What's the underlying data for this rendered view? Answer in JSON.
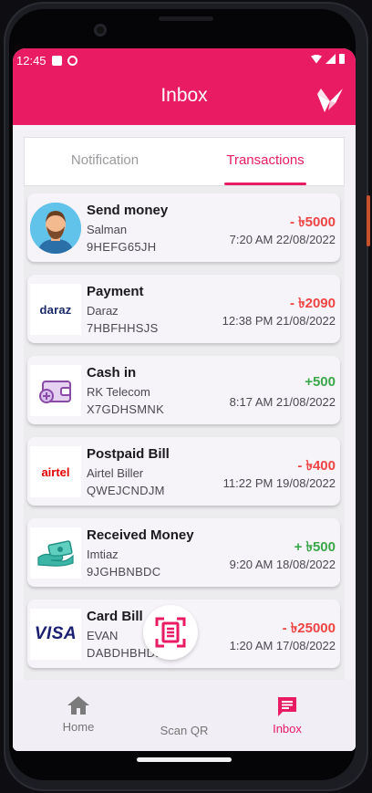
{
  "status_bar": {
    "time": "12:45"
  },
  "app_bar": {
    "title": "Inbox",
    "logo_icon": "bird-logo-icon"
  },
  "tabs": [
    {
      "label": "Notification",
      "selected": false
    },
    {
      "label": "Transactions",
      "selected": true
    }
  ],
  "transactions": [
    {
      "type": "Send money",
      "party": "Salman",
      "id": "9HEFG65JH",
      "amount": "- ৳5000",
      "datetime": "7:20 AM 22/08/2022",
      "direction": "debit",
      "icon": "avatar-icon"
    },
    {
      "type": "Payment",
      "party": "Daraz",
      "id": "7HBFHHSJS",
      "amount": "- ৳2090",
      "datetime": "12:38 PM 21/08/2022",
      "direction": "debit",
      "icon": "daraz-logo",
      "logo_text": "daraz"
    },
    {
      "type": "Cash in",
      "party": "RK Telecom",
      "id": "X7GDHSMNK",
      "amount": "+500",
      "datetime": "8:17 AM 21/08/2022",
      "direction": "credit",
      "icon": "wallet-icon"
    },
    {
      "type": "Postpaid Bill",
      "party": "Airtel Biller",
      "id": "QWEJCNDJM",
      "amount": "- ৳400",
      "datetime": "11:22 PM 19/08/2022",
      "direction": "debit",
      "icon": "airtel-logo",
      "logo_text": "airtel"
    },
    {
      "type": "Received Money",
      "party": "Imtiaz",
      "id": "9JGHBNBDC",
      "amount": "+ ৳500",
      "datetime": "9:20 AM 18/08/2022",
      "direction": "credit",
      "icon": "cash-hand-icon"
    },
    {
      "type": "Card Bill",
      "party": "EVAN",
      "id": "DABDHBHDD",
      "amount": "- ৳25000",
      "datetime": "1:20 AM 17/08/2022",
      "direction": "debit",
      "icon": "visa-logo",
      "logo_text": "VISA"
    }
  ],
  "bottom_nav": [
    {
      "label": "Home",
      "icon": "home-icon",
      "selected": false
    },
    {
      "label": "Scan QR",
      "icon": "scan-qr-icon",
      "selected": false
    },
    {
      "label": "Inbox",
      "icon": "inbox-icon",
      "selected": true
    }
  ],
  "colors": {
    "brand": "#e81b63",
    "debit": "#ef4444",
    "credit": "#3aa84a"
  }
}
